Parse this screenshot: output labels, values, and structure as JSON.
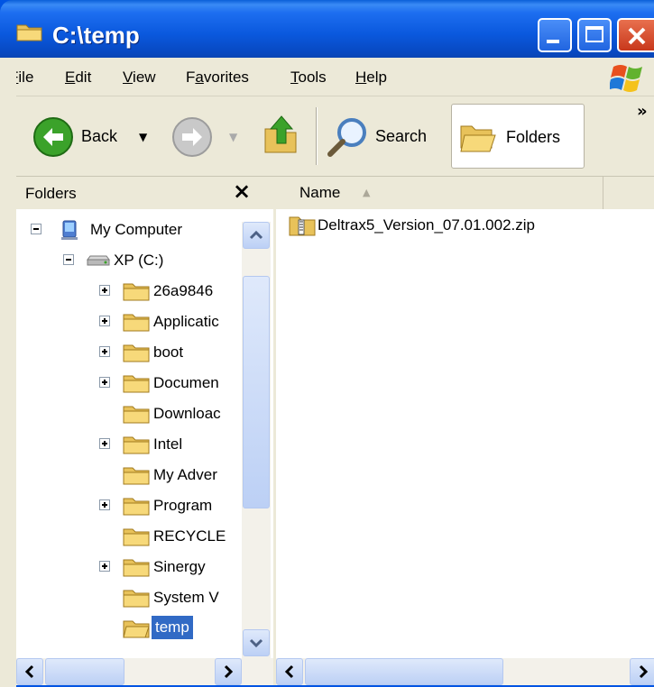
{
  "window": {
    "title": "C:\\temp",
    "colors": {
      "titlebar": "#0a58dd",
      "chrome": "#ece9d8",
      "selection": "#316ac5"
    }
  },
  "menu": {
    "items": [
      {
        "label": "File",
        "accel": "F",
        "rest": "ile"
      },
      {
        "label": "Edit",
        "accel": "E",
        "rest": "dit"
      },
      {
        "label": "View",
        "accel": "V",
        "rest": "iew"
      },
      {
        "label": "Favorites",
        "pre": "F",
        "accel": "a",
        "rest": "vorites"
      },
      {
        "label": "Tools",
        "accel": "T",
        "rest": "ools"
      },
      {
        "label": "Help",
        "accel": "H",
        "rest": "elp"
      }
    ]
  },
  "toolbar": {
    "back_label": "Back",
    "search_label": "Search",
    "folders_label": "Folders",
    "overflow_label": "»"
  },
  "folders_pane": {
    "title": "Folders",
    "close_glyph": "×",
    "tree": [
      {
        "label": "My Computer",
        "icon": "computer-icon",
        "expander": "minus"
      },
      {
        "label": "XP (C:)",
        "icon": "drive-icon",
        "expander": "minus"
      },
      {
        "label": "26a9846",
        "icon": "folder-icon",
        "expander": "plus"
      },
      {
        "label": "Applicatic",
        "icon": "folder-icon",
        "expander": "plus"
      },
      {
        "label": "boot",
        "icon": "folder-icon",
        "expander": "plus"
      },
      {
        "label": "Documen",
        "icon": "folder-icon",
        "expander": "plus"
      },
      {
        "label": "Downloac",
        "icon": "folder-icon",
        "expander": ""
      },
      {
        "label": "Intel",
        "icon": "folder-icon",
        "expander": "plus"
      },
      {
        "label": "My Adver",
        "icon": "folder-icon",
        "expander": ""
      },
      {
        "label": "Program",
        "icon": "folder-icon",
        "expander": "plus"
      },
      {
        "label": "RECYCLE",
        "icon": "folder-icon",
        "expander": ""
      },
      {
        "label": "Sinergy",
        "icon": "folder-icon",
        "expander": "plus"
      },
      {
        "label": "System V",
        "icon": "folder-icon",
        "expander": ""
      },
      {
        "label": "temp",
        "icon": "open-folder-icon",
        "expander": "",
        "selected": true
      }
    ]
  },
  "list_pane": {
    "column_name": "Name",
    "sort_glyph": "▲",
    "files": [
      {
        "name": "Deltrax5_Version_07.01.002.zip",
        "icon": "zip-icon"
      }
    ]
  }
}
